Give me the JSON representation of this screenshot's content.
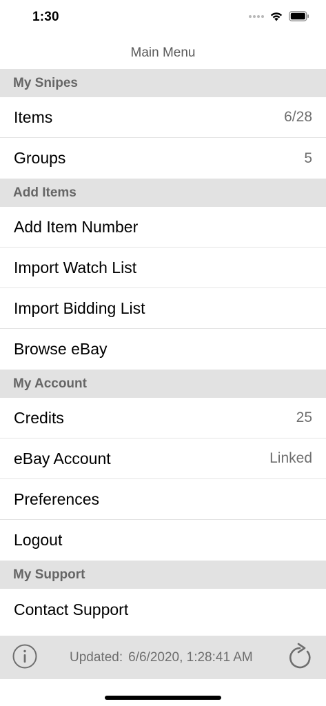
{
  "status_bar": {
    "time": "1:30"
  },
  "nav": {
    "title": "Main Menu"
  },
  "sections": {
    "snipes": {
      "header": "My Snipes",
      "items": {
        "label": "Items",
        "value": "6/28"
      },
      "groups": {
        "label": "Groups",
        "value": "5"
      }
    },
    "add_items": {
      "header": "Add Items",
      "add_item_number": {
        "label": "Add Item Number"
      },
      "import_watch_list": {
        "label": "Import Watch List"
      },
      "import_bidding_list": {
        "label": "Import Bidding List"
      },
      "browse_ebay": {
        "label": "Browse eBay"
      }
    },
    "account": {
      "header": "My Account",
      "credits": {
        "label": "Credits",
        "value": "25"
      },
      "ebay_account": {
        "label": "eBay Account",
        "value": "Linked"
      },
      "preferences": {
        "label": "Preferences"
      },
      "logout": {
        "label": "Logout"
      }
    },
    "support": {
      "header": "My Support",
      "contact_support": {
        "label": "Contact Support"
      }
    }
  },
  "toolbar": {
    "updated_label": "Updated:",
    "updated_value": "6/6/2020, 1:28:41 AM",
    "info_icon": "info-circle-icon",
    "refresh_icon": "refresh-icon"
  },
  "colors": {
    "section_header_bg": "#e2e2e2",
    "section_header_text": "#666666",
    "secondary_text": "#6e6e6e",
    "divider": "#e4e4e4"
  }
}
